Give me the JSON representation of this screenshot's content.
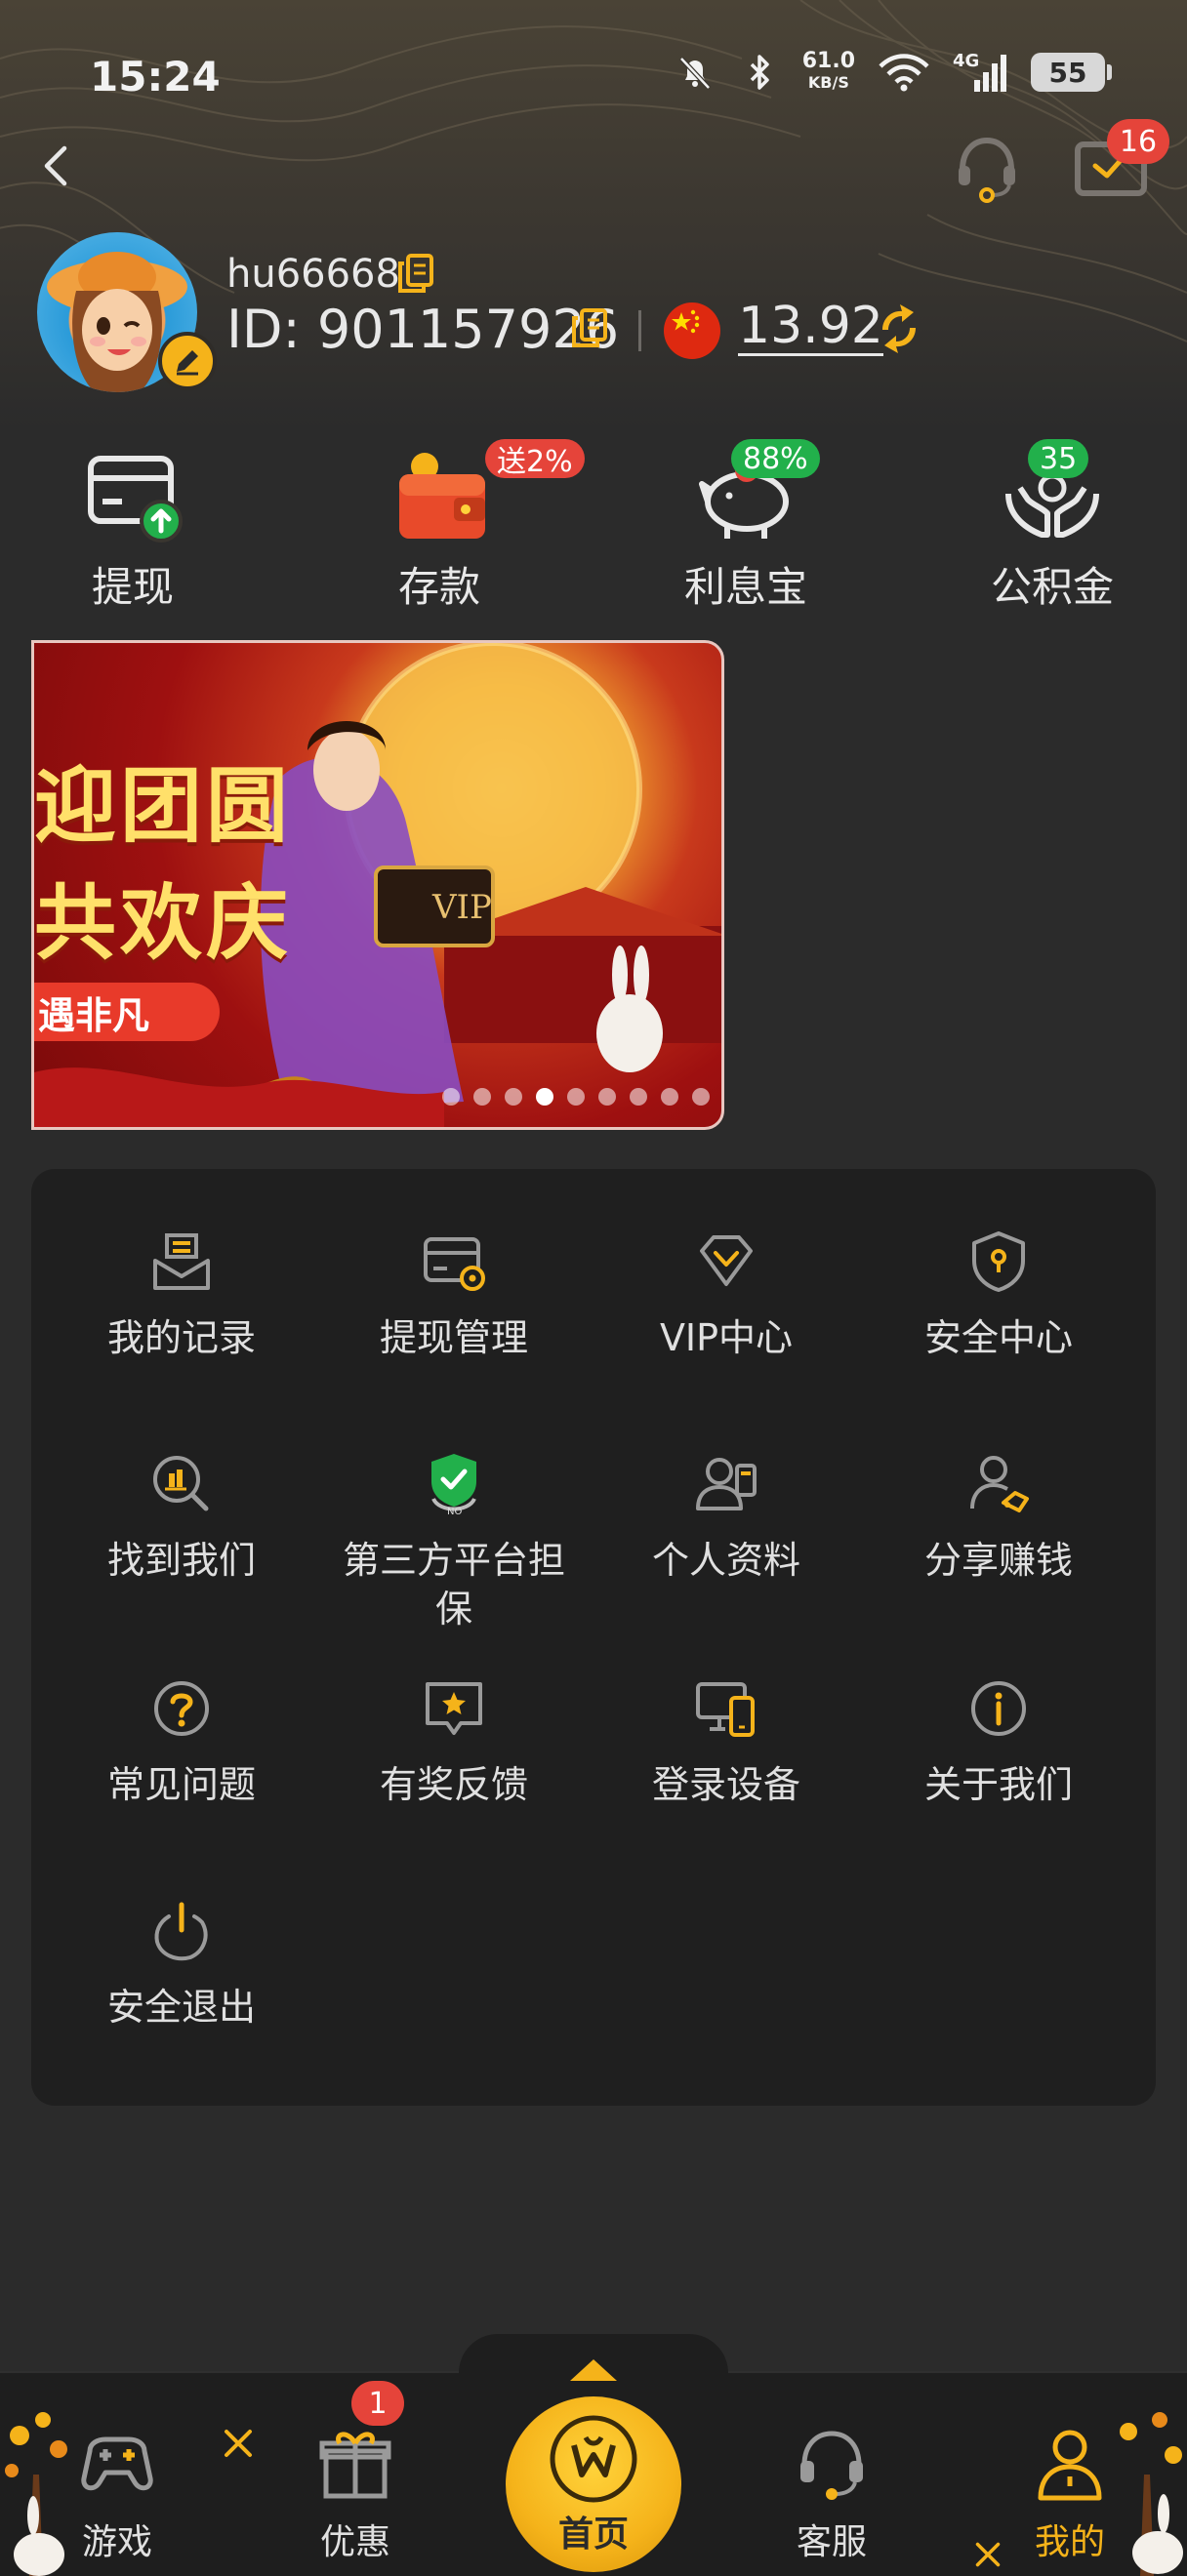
{
  "status_bar": {
    "time": "15:24",
    "net_speed": "61.0",
    "net_unit": "KB/S",
    "network": "4G",
    "battery": "55"
  },
  "header": {
    "mail_badge": "16"
  },
  "profile": {
    "username": "hu66668",
    "id_label": "ID: 901157926",
    "balance": "13.92"
  },
  "quick_actions": [
    {
      "label": "提现",
      "badge": ""
    },
    {
      "label": "存款",
      "badge": "送2%"
    },
    {
      "label": "利息宝",
      "badge": "88%"
    },
    {
      "label": "公积金",
      "badge": "35"
    }
  ],
  "banner": {
    "line1": "迎团圆",
    "line2": "共欢庆",
    "tag": "遇非凡",
    "dots_total": 10,
    "dots_active": 4
  },
  "menu": [
    {
      "label": "我的记录",
      "icon": "records-icon"
    },
    {
      "label": "提现管理",
      "icon": "withdraw-manage-icon"
    },
    {
      "label": "VIP中心",
      "icon": "vip-icon"
    },
    {
      "label": "安全中心",
      "icon": "security-icon"
    },
    {
      "label": "找到我们",
      "icon": "find-us-icon"
    },
    {
      "label": "第三方平台担保",
      "icon": "guarantee-icon"
    },
    {
      "label": "个人资料",
      "icon": "profile-icon"
    },
    {
      "label": "分享赚钱",
      "icon": "share-icon"
    },
    {
      "label": "常见问题",
      "icon": "faq-icon"
    },
    {
      "label": "有奖反馈",
      "icon": "feedback-icon"
    },
    {
      "label": "登录设备",
      "icon": "devices-icon"
    },
    {
      "label": "关于我们",
      "icon": "about-icon"
    },
    {
      "label": "安全退出",
      "icon": "logout-icon"
    }
  ],
  "bottom_nav": {
    "games": "游戏",
    "offers": "优惠",
    "offers_badge": "1",
    "home": "首页",
    "service": "客服",
    "mine": "我的"
  },
  "colors": {
    "accent": "#f5b31a",
    "badge_red": "#e5443a",
    "badge_green": "#22b04b",
    "panel": "#1f1f1f"
  }
}
